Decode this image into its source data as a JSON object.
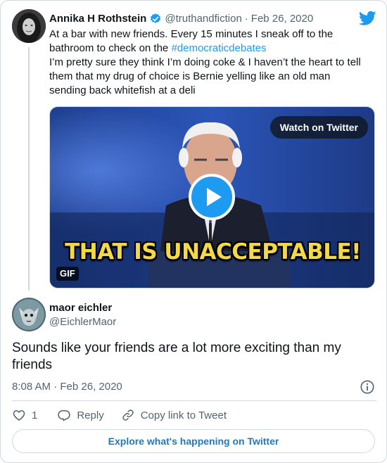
{
  "parent_tweet": {
    "author_name": "Annika H Rothstein",
    "author_handle": "@truthandfiction",
    "separator": "·",
    "date": "Feb 26, 2020",
    "text_part1": "At a bar with new friends. Every 15 minutes I sneak off to the bathroom to check on the ",
    "hashtag": "#democraticdebates",
    "text_part2": "I’m pretty sure they think I’m doing coke & I haven’t the heart to tell them that my drug of choice is Bernie yelling like an old man sending back whitefish at a deli",
    "media": {
      "watch_label": "Watch on Twitter",
      "caption": "THAT IS UNACCEPTABLE!",
      "badge": "GIF"
    }
  },
  "reply_tweet": {
    "author_name": "maor eichler",
    "author_handle": "@EichlerMaor",
    "text": "Sounds like your friends are a lot more exciting than my friends",
    "timestamp": "8:08 AM · Feb 26, 2020"
  },
  "actions": {
    "like_count": "1",
    "reply_label": "Reply",
    "copy_label": "Copy link to Tweet"
  },
  "footer": {
    "explore_label": "Explore what's happening on Twitter"
  },
  "colors": {
    "accent": "#1d9bf0",
    "muted": "#536471",
    "border": "#cfd9de",
    "caption": "#f3d84a"
  },
  "icons": [
    "twitter-bird-icon",
    "verified-badge-icon",
    "play-icon",
    "info-icon",
    "heart-icon",
    "reply-icon",
    "link-icon"
  ]
}
